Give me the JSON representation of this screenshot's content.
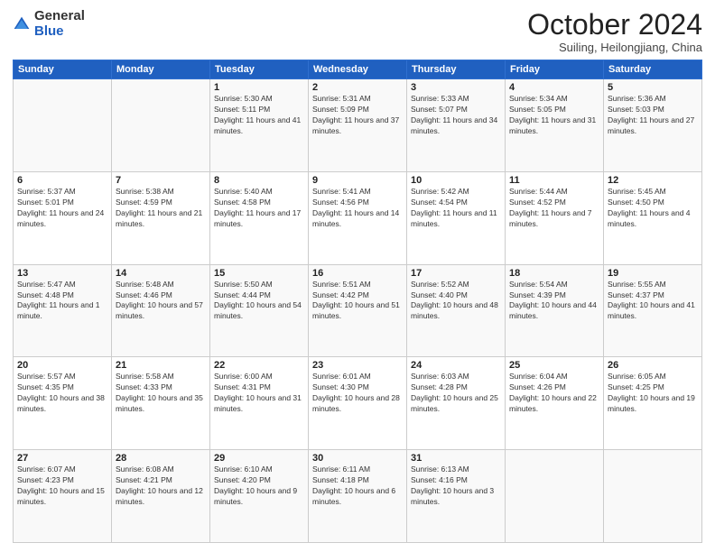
{
  "logo": {
    "general": "General",
    "blue": "Blue"
  },
  "header": {
    "month": "October 2024",
    "location": "Suiling, Heilongjiang, China"
  },
  "weekdays": [
    "Sunday",
    "Monday",
    "Tuesday",
    "Wednesday",
    "Thursday",
    "Friday",
    "Saturday"
  ],
  "weeks": [
    [
      {
        "day": "",
        "info": ""
      },
      {
        "day": "",
        "info": ""
      },
      {
        "day": "1",
        "info": "Sunrise: 5:30 AM\nSunset: 5:11 PM\nDaylight: 11 hours and 41 minutes."
      },
      {
        "day": "2",
        "info": "Sunrise: 5:31 AM\nSunset: 5:09 PM\nDaylight: 11 hours and 37 minutes."
      },
      {
        "day": "3",
        "info": "Sunrise: 5:33 AM\nSunset: 5:07 PM\nDaylight: 11 hours and 34 minutes."
      },
      {
        "day": "4",
        "info": "Sunrise: 5:34 AM\nSunset: 5:05 PM\nDaylight: 11 hours and 31 minutes."
      },
      {
        "day": "5",
        "info": "Sunrise: 5:36 AM\nSunset: 5:03 PM\nDaylight: 11 hours and 27 minutes."
      }
    ],
    [
      {
        "day": "6",
        "info": "Sunrise: 5:37 AM\nSunset: 5:01 PM\nDaylight: 11 hours and 24 minutes."
      },
      {
        "day": "7",
        "info": "Sunrise: 5:38 AM\nSunset: 4:59 PM\nDaylight: 11 hours and 21 minutes."
      },
      {
        "day": "8",
        "info": "Sunrise: 5:40 AM\nSunset: 4:58 PM\nDaylight: 11 hours and 17 minutes."
      },
      {
        "day": "9",
        "info": "Sunrise: 5:41 AM\nSunset: 4:56 PM\nDaylight: 11 hours and 14 minutes."
      },
      {
        "day": "10",
        "info": "Sunrise: 5:42 AM\nSunset: 4:54 PM\nDaylight: 11 hours and 11 minutes."
      },
      {
        "day": "11",
        "info": "Sunrise: 5:44 AM\nSunset: 4:52 PM\nDaylight: 11 hours and 7 minutes."
      },
      {
        "day": "12",
        "info": "Sunrise: 5:45 AM\nSunset: 4:50 PM\nDaylight: 11 hours and 4 minutes."
      }
    ],
    [
      {
        "day": "13",
        "info": "Sunrise: 5:47 AM\nSunset: 4:48 PM\nDaylight: 11 hours and 1 minute."
      },
      {
        "day": "14",
        "info": "Sunrise: 5:48 AM\nSunset: 4:46 PM\nDaylight: 10 hours and 57 minutes."
      },
      {
        "day": "15",
        "info": "Sunrise: 5:50 AM\nSunset: 4:44 PM\nDaylight: 10 hours and 54 minutes."
      },
      {
        "day": "16",
        "info": "Sunrise: 5:51 AM\nSunset: 4:42 PM\nDaylight: 10 hours and 51 minutes."
      },
      {
        "day": "17",
        "info": "Sunrise: 5:52 AM\nSunset: 4:40 PM\nDaylight: 10 hours and 48 minutes."
      },
      {
        "day": "18",
        "info": "Sunrise: 5:54 AM\nSunset: 4:39 PM\nDaylight: 10 hours and 44 minutes."
      },
      {
        "day": "19",
        "info": "Sunrise: 5:55 AM\nSunset: 4:37 PM\nDaylight: 10 hours and 41 minutes."
      }
    ],
    [
      {
        "day": "20",
        "info": "Sunrise: 5:57 AM\nSunset: 4:35 PM\nDaylight: 10 hours and 38 minutes."
      },
      {
        "day": "21",
        "info": "Sunrise: 5:58 AM\nSunset: 4:33 PM\nDaylight: 10 hours and 35 minutes."
      },
      {
        "day": "22",
        "info": "Sunrise: 6:00 AM\nSunset: 4:31 PM\nDaylight: 10 hours and 31 minutes."
      },
      {
        "day": "23",
        "info": "Sunrise: 6:01 AM\nSunset: 4:30 PM\nDaylight: 10 hours and 28 minutes."
      },
      {
        "day": "24",
        "info": "Sunrise: 6:03 AM\nSunset: 4:28 PM\nDaylight: 10 hours and 25 minutes."
      },
      {
        "day": "25",
        "info": "Sunrise: 6:04 AM\nSunset: 4:26 PM\nDaylight: 10 hours and 22 minutes."
      },
      {
        "day": "26",
        "info": "Sunrise: 6:05 AM\nSunset: 4:25 PM\nDaylight: 10 hours and 19 minutes."
      }
    ],
    [
      {
        "day": "27",
        "info": "Sunrise: 6:07 AM\nSunset: 4:23 PM\nDaylight: 10 hours and 15 minutes."
      },
      {
        "day": "28",
        "info": "Sunrise: 6:08 AM\nSunset: 4:21 PM\nDaylight: 10 hours and 12 minutes."
      },
      {
        "day": "29",
        "info": "Sunrise: 6:10 AM\nSunset: 4:20 PM\nDaylight: 10 hours and 9 minutes."
      },
      {
        "day": "30",
        "info": "Sunrise: 6:11 AM\nSunset: 4:18 PM\nDaylight: 10 hours and 6 minutes."
      },
      {
        "day": "31",
        "info": "Sunrise: 6:13 AM\nSunset: 4:16 PM\nDaylight: 10 hours and 3 minutes."
      },
      {
        "day": "",
        "info": ""
      },
      {
        "day": "",
        "info": ""
      }
    ]
  ]
}
